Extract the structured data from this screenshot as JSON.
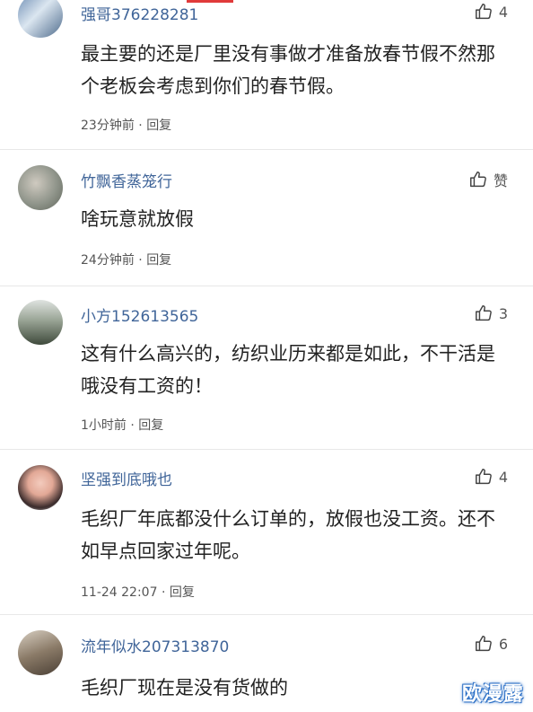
{
  "comments": [
    {
      "user": "强哥376228281",
      "likes": "4",
      "text": "最主要的还是厂里没有事做才准备放春节假不然那个老板会考虑到你们的春节假。",
      "time": "23分钟前",
      "reply": "回复",
      "avatar_colors": [
        "#5a7a9a",
        "#c9d6e2"
      ]
    },
    {
      "user": "竹飘香蒸笼行",
      "likes": "赞",
      "text": "啥玩意就放假",
      "time": "24分钟前",
      "reply": "回复",
      "avatar_colors": [
        "#8a8f86",
        "#c8c4bb"
      ]
    },
    {
      "user": "小方152613565",
      "likes": "3",
      "text": "这有什么高兴的，纺织业历来都是如此，不干活是哦没有工资的！",
      "time": "1小时前",
      "reply": "回复",
      "avatar_colors": [
        "#5d6b58",
        "#9fb09a"
      ]
    },
    {
      "user": "坚强到底哦也",
      "likes": "4",
      "text": "毛织厂年底都没什么订单的，放假也没工资。还不如早点回家过年呢。",
      "time": "11-24 22:07",
      "reply": "回复",
      "avatar_colors": [
        "#e9b8a8",
        "#3a2b2b"
      ]
    },
    {
      "user": "流年似水207313870",
      "likes": "6",
      "text": "毛织厂现在是没有货做的",
      "time": "",
      "reply": "",
      "avatar_colors": [
        "#7b6c5c",
        "#cfc4b4"
      ]
    }
  ],
  "separator": "·",
  "watermark": "欧漫露",
  "colors": {
    "username": "#406599",
    "accent_bar": "#e03a3a"
  },
  "icons": {
    "like": "thumbs-up-icon"
  }
}
